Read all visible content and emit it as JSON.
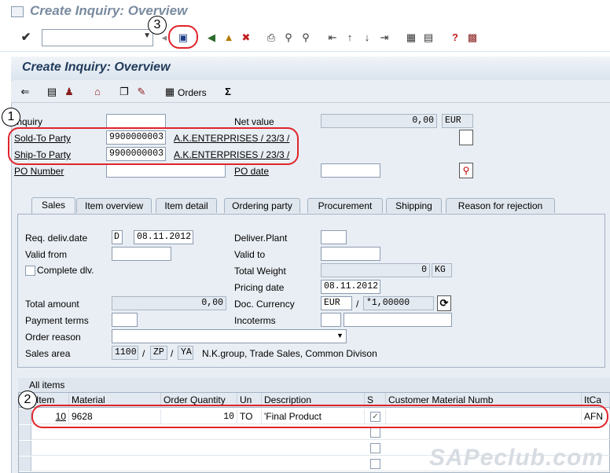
{
  "window": {
    "title": "Create Inquiry: Overview"
  },
  "screen": {
    "title": "Create Inquiry: Overview"
  },
  "app_toolbar": {
    "orders_label": "Orders"
  },
  "header": {
    "inquiry_label": "Inquiry",
    "inquiry_value": "",
    "net_value_label": "Net value",
    "net_value": "0,00",
    "currency": "EUR",
    "sold_to_label": "Sold-To Party",
    "sold_to_value": "9900000003",
    "sold_to_desc": "A.K.ENTERPRISES / 23/3 /",
    "ship_to_label": "Ship-To Party",
    "ship_to_value": "9900000003",
    "ship_to_desc": "A.K.ENTERPRISES / 23/3 /",
    "po_number_label": "PO Number",
    "po_number_value": "",
    "po_date_label": "PO date",
    "po_date_value": ""
  },
  "tabs": [
    "Sales",
    "Item overview",
    "Item detail",
    "Ordering party",
    "Procurement",
    "Shipping",
    "Reason for rejection"
  ],
  "sales": {
    "req_deliv_label": "Req. deliv.date",
    "req_deliv_type": "D",
    "req_deliv_value": "08.11.2012",
    "deliver_plant_label": "Deliver.Plant",
    "valid_from_label": "Valid from",
    "valid_to_label": "Valid to",
    "complete_dlv_label": "Complete dlv.",
    "total_weight_label": "Total Weight",
    "total_weight_value": "0",
    "weight_unit": "KG",
    "pricing_date_label": "Pricing date",
    "pricing_date_value": "08.11.2012",
    "total_amount_label": "Total amount",
    "total_amount_value": "0,00",
    "doc_currency_label": "Doc. Currency",
    "doc_currency_value": "EUR",
    "exchange_rate": "*1,00000",
    "payment_terms_label": "Payment terms",
    "incoterms_label": "Incoterms",
    "order_reason_label": "Order reason",
    "sales_area_label": "Sales area",
    "sales_org": "1100",
    "dist_channel": "ZP",
    "division": "YA",
    "sales_area_desc": "N.K.group, Trade Sales, Common Divison"
  },
  "items": {
    "title": "All items",
    "columns": [
      "Item",
      "Material",
      "Order Quantity",
      "Un",
      "Description",
      "S",
      "Customer Material Numb",
      "ItCa"
    ],
    "rows": [
      {
        "item": "10",
        "material": "9628",
        "qty": "10",
        "unit": "TO",
        "desc": "'Final Product",
        "s": true,
        "cust_mat": "",
        "itca": "AFN"
      }
    ]
  },
  "annotations": [
    "1",
    "2",
    "3"
  ],
  "watermark": "SAPeclub.com"
}
